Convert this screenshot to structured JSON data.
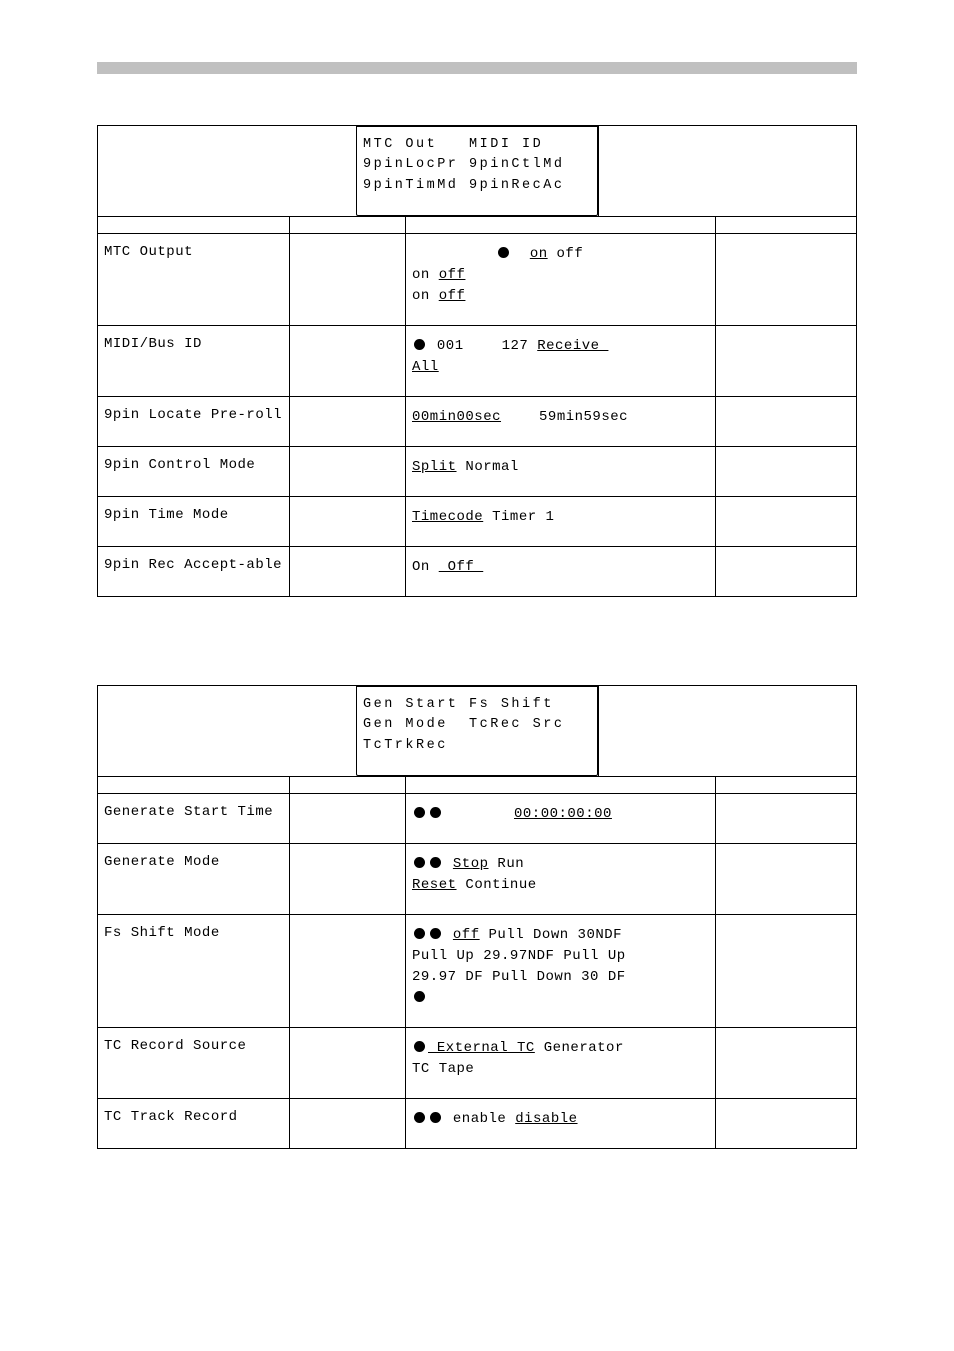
{
  "section1": {
    "popup": {
      "l1a": "MTC Out",
      "l1b": "MIDI ID",
      "l2a": "9pinLocPr",
      "l2b": "9pinCtlMd",
      "l3a": "9pinTimMd",
      "l3b": "9pinRecAc"
    },
    "rows": [
      {
        "name": "MTC Output",
        "options_html": "<span class='lead'></span><span class='dot'></span>&nbsp;&nbsp;<span class='u'>on</span>&nbsp;off<br>on <span class='u'>off</span><br>on <span class='u'>off</span>"
      },
      {
        "name": "MIDI/Bus ID",
        "options_html": "<span class='dot'></span>&nbsp;001<span class='gap'></span>127 <span class='u'>Receive&nbsp;</span><br><span class='u'>All</span>"
      },
      {
        "name": "9pin Locate Pre-roll",
        "options_html": "<span class='u'>00min00sec</span><span class='gap'></span>59min59sec"
      },
      {
        "name": "9pin Control Mode",
        "options_html": "<span class='u'>Split</span>&nbsp;Normal"
      },
      {
        "name": "9pin Time Mode",
        "options_html": "<span class='u'>Timecode</span>&nbsp;Timer 1"
      },
      {
        "name": "9pin Rec Accept-able",
        "options_html": "On&nbsp;<span class='u'>&nbsp;Off&nbsp;</span>"
      }
    ]
  },
  "section2": {
    "popup": {
      "l1a": "Gen Start",
      "l1b": "Fs Shift",
      "l2a": "Gen Mode",
      "l2b": "TcRec Src",
      "l3a": "TcTrkRec",
      "l3b": ""
    },
    "rows": [
      {
        "name": "Generate Start Time",
        "options_html": "<span class='dot'></span><span class='dot'></span><span class='biggap'></span><span class='u'>00:00:00:00</span>"
      },
      {
        "name": "Generate Mode",
        "options_html": "<span class='dot'></span><span class='dot'></span>&nbsp;<span class='u'>Stop</span>&nbsp;Run<br><span class='u'>Reset</span>&nbsp;Continue"
      },
      {
        "name": "Fs Shift Mode",
        "options_html": "<span class='dot'></span><span class='dot'></span>&nbsp;<span class='u'>off</span>&nbsp;Pull Down 30NDF<br>Pull Up 29.97NDF Pull Up<br>29.97 DF Pull Down 30 DF<br><span class='dot'></span>"
      },
      {
        "name": "TC Record Source",
        "options_html": "<span class='u'><span class='dot'></span>&nbsp;External TC</span>&nbsp;Generator<br>TC Tape"
      },
      {
        "name": "TC Track Record",
        "options_html": "<span class='dot'></span><span class='dot'></span>&nbsp;enable&nbsp;<span class='u'>disable</span>"
      }
    ]
  }
}
